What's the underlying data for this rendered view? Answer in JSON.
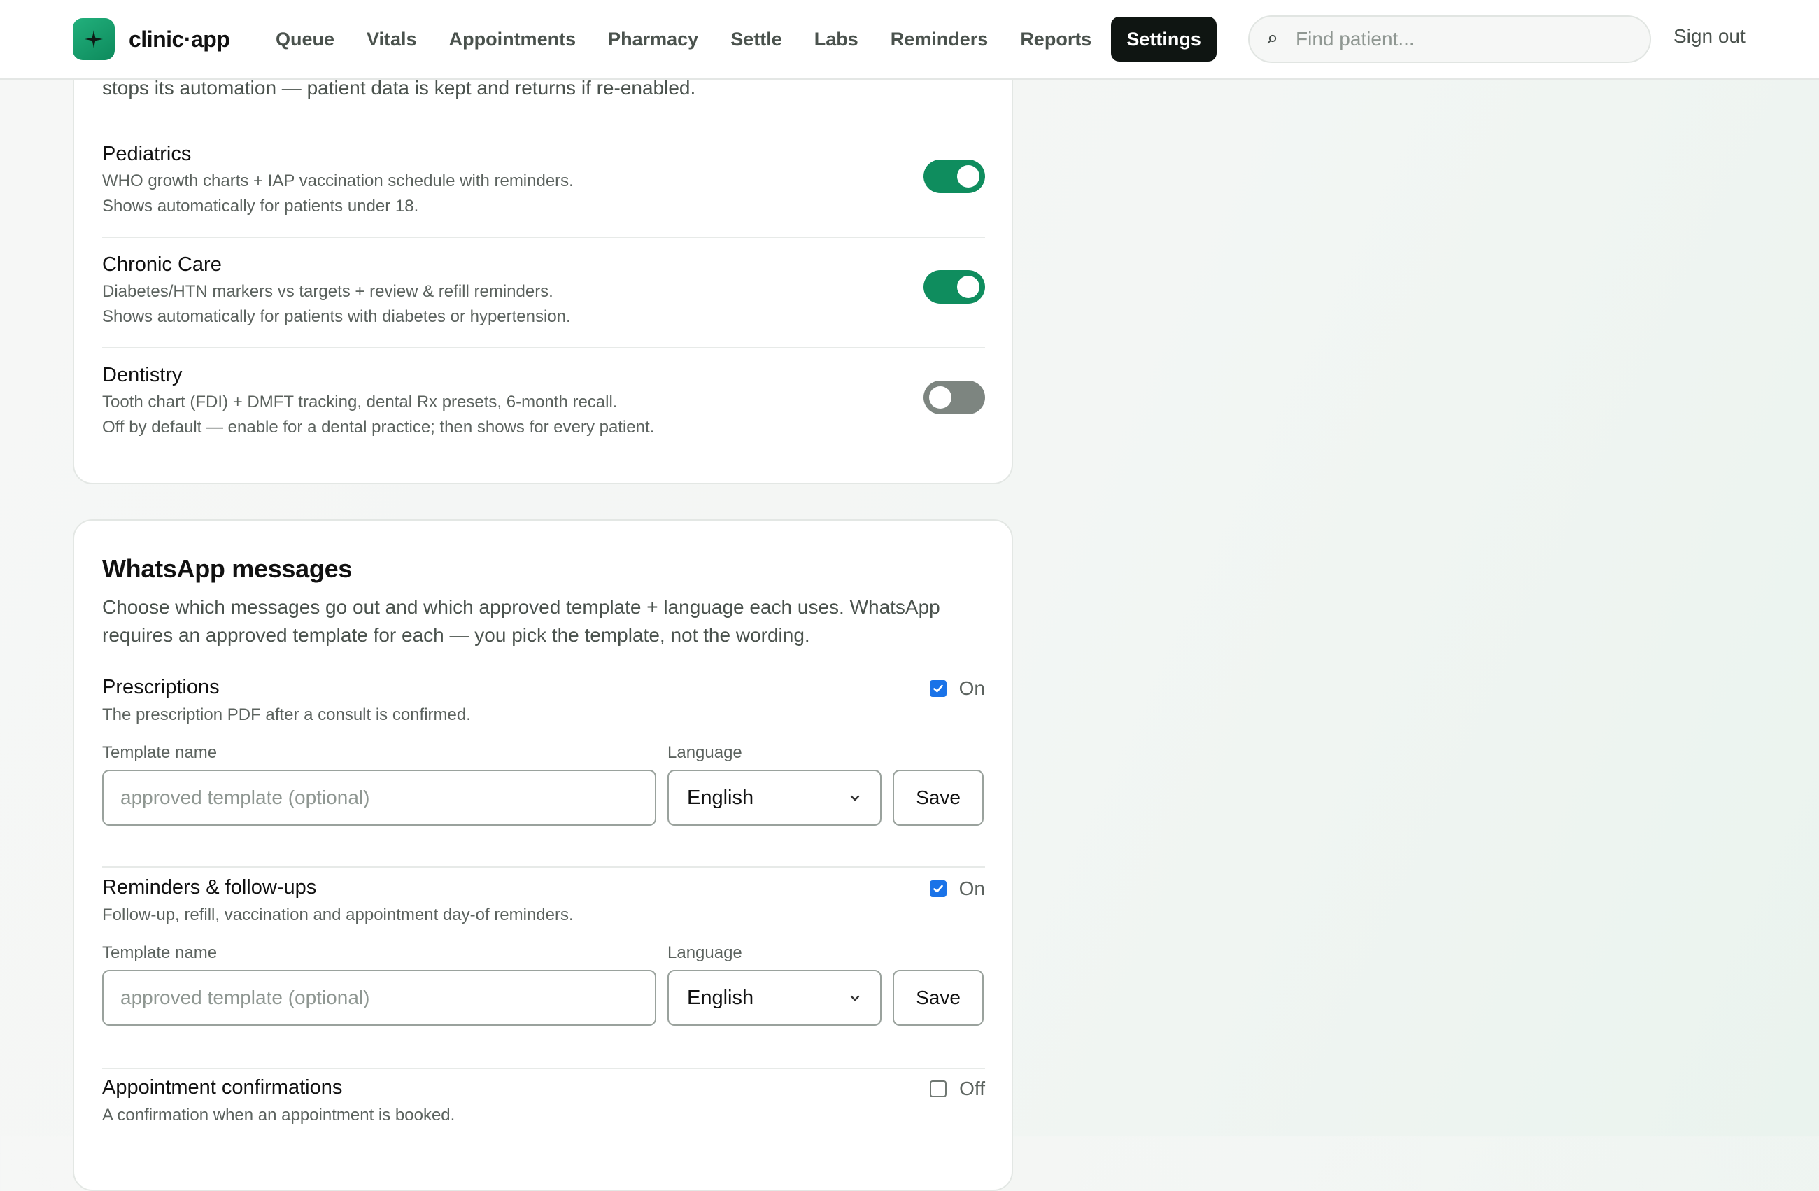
{
  "app": {
    "name": "clinic·app"
  },
  "nav": {
    "items": [
      "Queue",
      "Vitals",
      "Appointments",
      "Pharmacy",
      "Settle",
      "Labs",
      "Reminders",
      "Reports"
    ],
    "active": "Settings"
  },
  "search": {
    "placeholder": "Find patient..."
  },
  "header": {
    "signout": "Sign out"
  },
  "modules": {
    "intro_tail": "stops its automation — patient data is kept and returns if re-enabled.",
    "items": [
      {
        "title": "Pediatrics",
        "desc1": "WHO growth charts + IAP vaccination schedule with reminders.",
        "desc2": "Shows automatically for patients under 18.",
        "enabled": true
      },
      {
        "title": "Chronic Care",
        "desc1": "Diabetes/HTN markers vs targets + review & refill reminders.",
        "desc2": "Shows automatically for patients with diabetes or hypertension.",
        "enabled": true
      },
      {
        "title": "Dentistry",
        "desc1": "Tooth chart (FDI) + DMFT tracking, dental Rx presets, 6-month recall.",
        "desc2": "Off by default — enable for a dental practice; then shows for every patient.",
        "enabled": false
      }
    ]
  },
  "whatsapp": {
    "title": "WhatsApp messages",
    "desc": "Choose which messages go out and which approved template + language each uses. WhatsApp requires an approved template for each — you pick the template, not the wording.",
    "template_label": "Template name",
    "template_placeholder": "approved template (optional)",
    "language_label": "Language",
    "save_label": "Save",
    "messages": [
      {
        "title": "Prescriptions",
        "desc": "The prescription PDF after a consult is confirmed.",
        "checked": true,
        "state": "On",
        "language": "English"
      },
      {
        "title": "Reminders & follow-ups",
        "desc": "Follow-up, refill, vaccination and appointment day-of reminders.",
        "checked": true,
        "state": "On",
        "language": "English"
      },
      {
        "title": "Appointment confirmations",
        "desc": "A confirmation when an appointment is booked.",
        "checked": false,
        "state": "Off"
      }
    ]
  },
  "colors": {
    "accent": "#0f8d5e",
    "nav_active_bg": "#0f1512",
    "checkbox": "#1a73e8",
    "toggle_off": "#7d8580"
  }
}
